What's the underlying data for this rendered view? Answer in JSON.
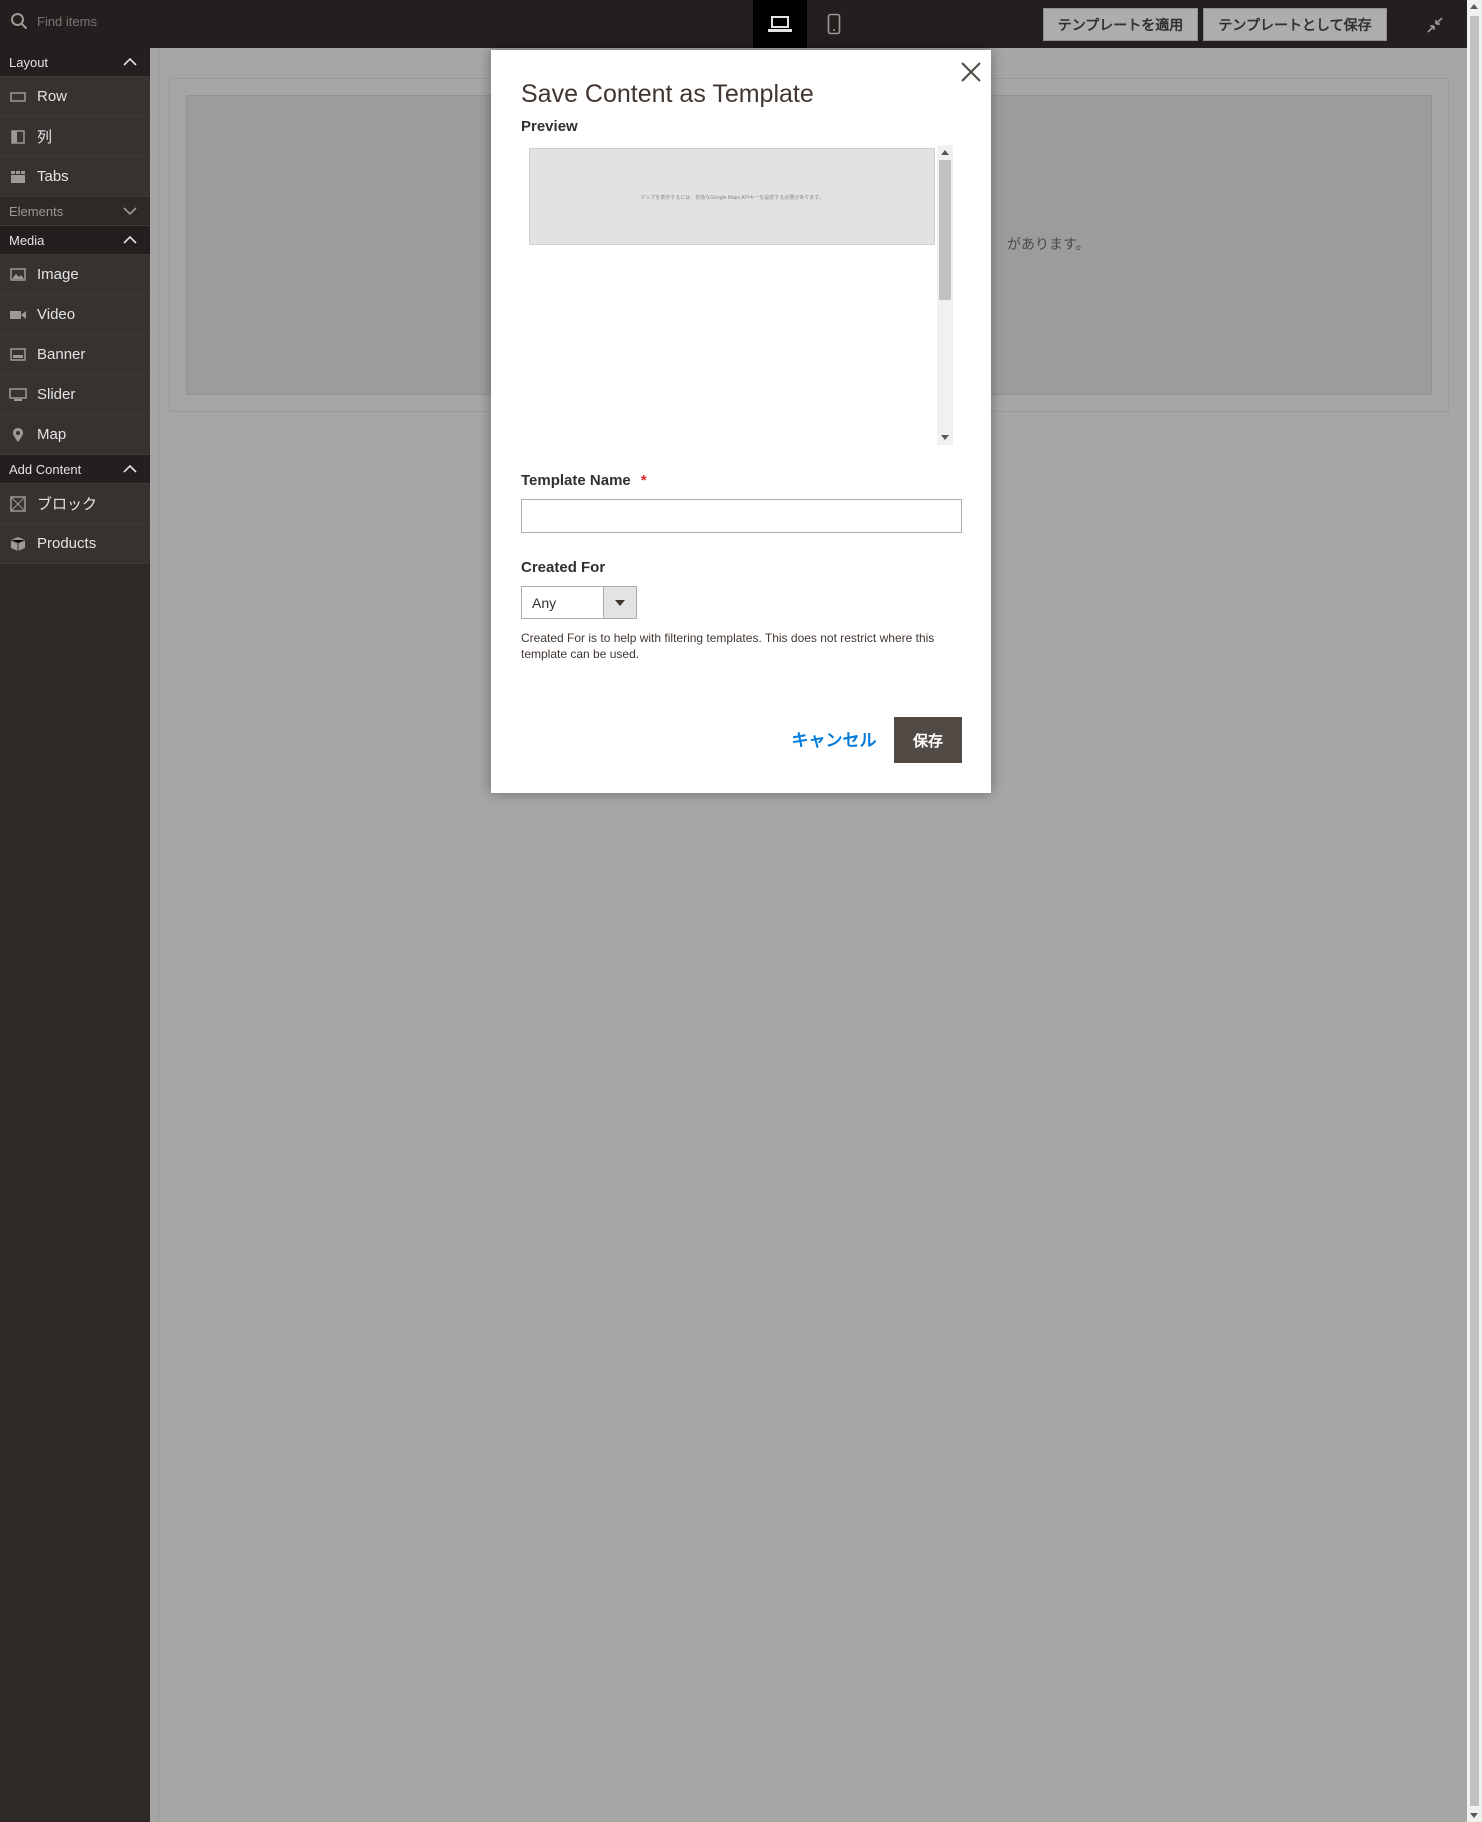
{
  "colors": {
    "toolbar_bg": "#221f1e",
    "sidebar_bg": "#2d2926",
    "overlay_bg": "#a6a6a6",
    "primary_button": "#514943",
    "link": "#007bdb",
    "required": "#e22626"
  },
  "toolbar": {
    "search_placeholder": "Find items",
    "search_icon": "search-icon",
    "device_desktop_icon": "laptop-icon",
    "device_mobile_icon": "mobile-icon",
    "apply_template_label": "テンプレートを適用",
    "save_as_template_label": "テンプレートとして保存",
    "collapse_icon": "minimize-icon"
  },
  "sidebar": {
    "groups": [
      {
        "label": "Layout",
        "expanded": true,
        "items": [
          {
            "label": "Row",
            "icon": "row-icon"
          },
          {
            "label": "列",
            "icon": "column-icon"
          },
          {
            "label": "Tabs",
            "icon": "tabs-icon"
          }
        ]
      },
      {
        "label": "Elements",
        "expanded": false,
        "items": []
      },
      {
        "label": "Media",
        "expanded": true,
        "items": [
          {
            "label": "Image",
            "icon": "image-icon"
          },
          {
            "label": "Video",
            "icon": "video-icon"
          },
          {
            "label": "Banner",
            "icon": "banner-icon"
          },
          {
            "label": "Slider",
            "icon": "slider-icon"
          },
          {
            "label": "Map",
            "icon": "map-pin-icon"
          }
        ]
      },
      {
        "label": "Add Content",
        "expanded": true,
        "items": [
          {
            "label": "ブロック",
            "icon": "block-icon"
          },
          {
            "label": "Products",
            "icon": "products-icon"
          }
        ]
      }
    ]
  },
  "stage": {
    "visible_text": "があります。"
  },
  "modal": {
    "title": "Save Content as Template",
    "preview_label": "Preview",
    "preview_text_before": "マップを表示するには、有効なGoogle Maps APIキーを設定する必要があります。",
    "template_name_label": "Template Name",
    "required_mark": "*",
    "template_name_value": "",
    "created_for_label": "Created For",
    "created_for_value": "Any",
    "help_text": "Created For is to help with filtering templates. This does not restrict where this template can be used.",
    "cancel_label": "キャンセル",
    "save_label": "保存",
    "close_icon": "close-icon"
  }
}
